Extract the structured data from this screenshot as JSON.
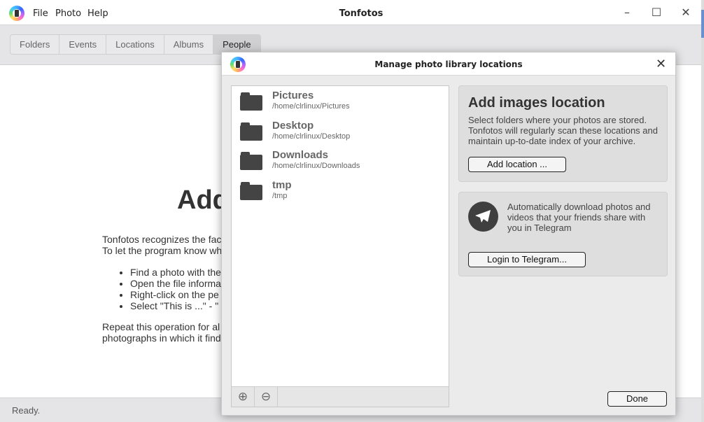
{
  "window": {
    "title": "Tonfotos",
    "menu": [
      "File",
      "Photo",
      "Help"
    ],
    "controls": {
      "minimize": "–",
      "maximize": "☐",
      "close": "✕"
    }
  },
  "tabs": [
    {
      "label": "Folders"
    },
    {
      "label": "Events"
    },
    {
      "label": "Locations"
    },
    {
      "label": "Albums"
    },
    {
      "label": "People",
      "active": true
    }
  ],
  "people_page": {
    "title": "Add",
    "intro": [
      "Tonfotos recognizes the fac",
      "To let the program know wh"
    ],
    "steps": [
      "Find a photo with the",
      "Open the file informa",
      "Right-click on the pe",
      "Select \"This is ...\" - \""
    ],
    "outro": [
      "Repeat this operation for al",
      "photographs in which it find"
    ]
  },
  "status": "Ready.",
  "dialog": {
    "title": "Manage photo library locations",
    "locations": [
      {
        "name": "Pictures",
        "path": "/home/clrlinux/Pictures"
      },
      {
        "name": "Desktop",
        "path": "/home/clrlinux/Desktop"
      },
      {
        "name": "Downloads",
        "path": "/home/clrlinux/Downloads"
      },
      {
        "name": "tmp",
        "path": "/tmp"
      }
    ],
    "add_card": {
      "title": "Add images location",
      "text": "Select folders where your photos are stored. Tonfotos will regularly scan these locations and maintain up-to-date index of your archive.",
      "button": "Add location ..."
    },
    "telegram_card": {
      "text": "Automatically download photos and videos that your friends share with you in Telegram",
      "button": "Login to Telegram..."
    },
    "done": "Done"
  }
}
